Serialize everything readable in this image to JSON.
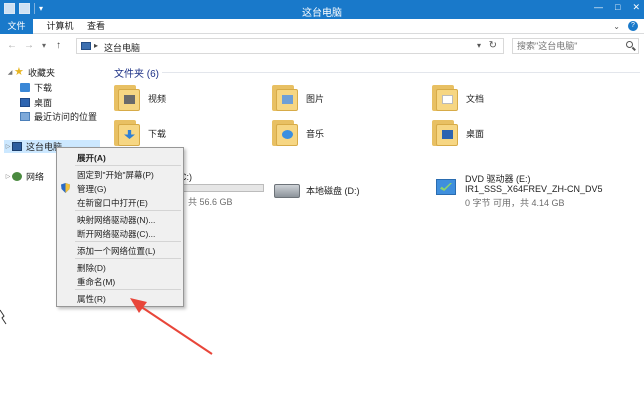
{
  "window": {
    "title": "这台电脑",
    "controls": [
      "—",
      "□",
      "✕"
    ]
  },
  "ribbon": {
    "tabs": [
      "文件",
      "计算机",
      "查看"
    ]
  },
  "nav": {
    "back": "←",
    "forward": "→",
    "recent": "▾",
    "up": "↑",
    "address": "这台电脑",
    "search_placeholder": "搜索\"这台电脑\""
  },
  "sidebar": {
    "favorites": "收藏夹",
    "items": [
      "下载",
      "桌面",
      "最近访问的位置"
    ],
    "this_pc": "这台电脑",
    "network": "网络"
  },
  "content": {
    "folders_header": "文件夹 (6)",
    "folders": [
      "视频",
      "图片",
      "文档",
      "下载",
      "音乐",
      "桌面"
    ],
    "devices": [
      {
        "name_visible": "C:)",
        "detail_visible": "共 56.6 GB"
      },
      {
        "name": "本地磁盘 (D:)"
      },
      {
        "name": "DVD 驱动器 (E:)",
        "label": "IR1_SSS_X64FREV_ZH-CN_DV5",
        "detail": "0 字节 可用，共 4.14 GB"
      }
    ]
  },
  "context_menu": {
    "items": [
      {
        "label": "展开(A)",
        "bold": true
      },
      {
        "label": "固定到\"开始\"屏幕(P)"
      },
      {
        "label": "管理(G)",
        "shield": true
      },
      {
        "label": "在新窗口中打开(E)"
      },
      {
        "label": "映射网络驱动器(N)..."
      },
      {
        "label": "断开网络驱动器(C)..."
      },
      {
        "label": "添加一个网络位置(L)"
      },
      {
        "label": "删除(D)"
      },
      {
        "label": "重命名(M)"
      },
      {
        "label": "属性(R)"
      }
    ]
  },
  "colors": {
    "accent": "#1979ca",
    "annotation_arrow": "#e8463a",
    "folder": "#f6d683"
  }
}
